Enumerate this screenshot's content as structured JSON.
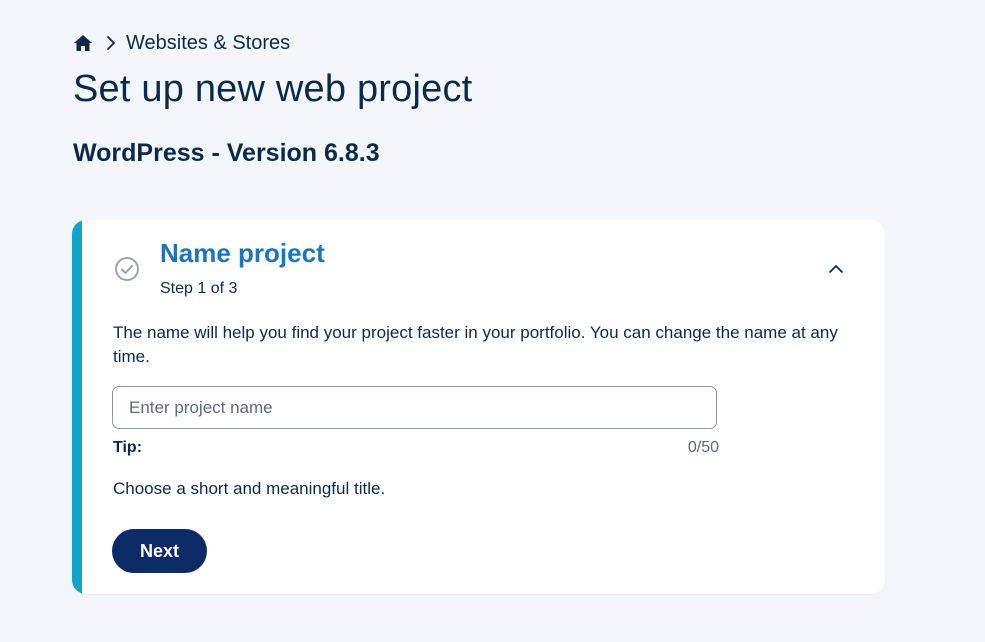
{
  "breadcrumb": {
    "home_icon": "home-icon",
    "separator_icon": "chevron-right-icon",
    "current": "Websites & Stores"
  },
  "page": {
    "title": "Set up new web project",
    "subtitle": "WordPress - Version 6.8.3"
  },
  "step": {
    "status_icon": "check-circle-icon",
    "title": "Name project",
    "count": "Step 1 of 3",
    "collapse_icon": "chevron-up-icon",
    "description": "The name will help you find your project faster in your portfolio. You can change the name at any time.",
    "input": {
      "placeholder": "Enter project name",
      "value": ""
    },
    "tip_label": "Tip:",
    "counter": "0/50",
    "tip_text": "Choose a short and meaningful title.",
    "next_label": "Next"
  },
  "colors": {
    "accent": "#11a4c8",
    "step_title": "#1f74ba",
    "primary_button": "#0b2a66",
    "text": "#0b2a4a",
    "background": "#f3f6fb"
  }
}
